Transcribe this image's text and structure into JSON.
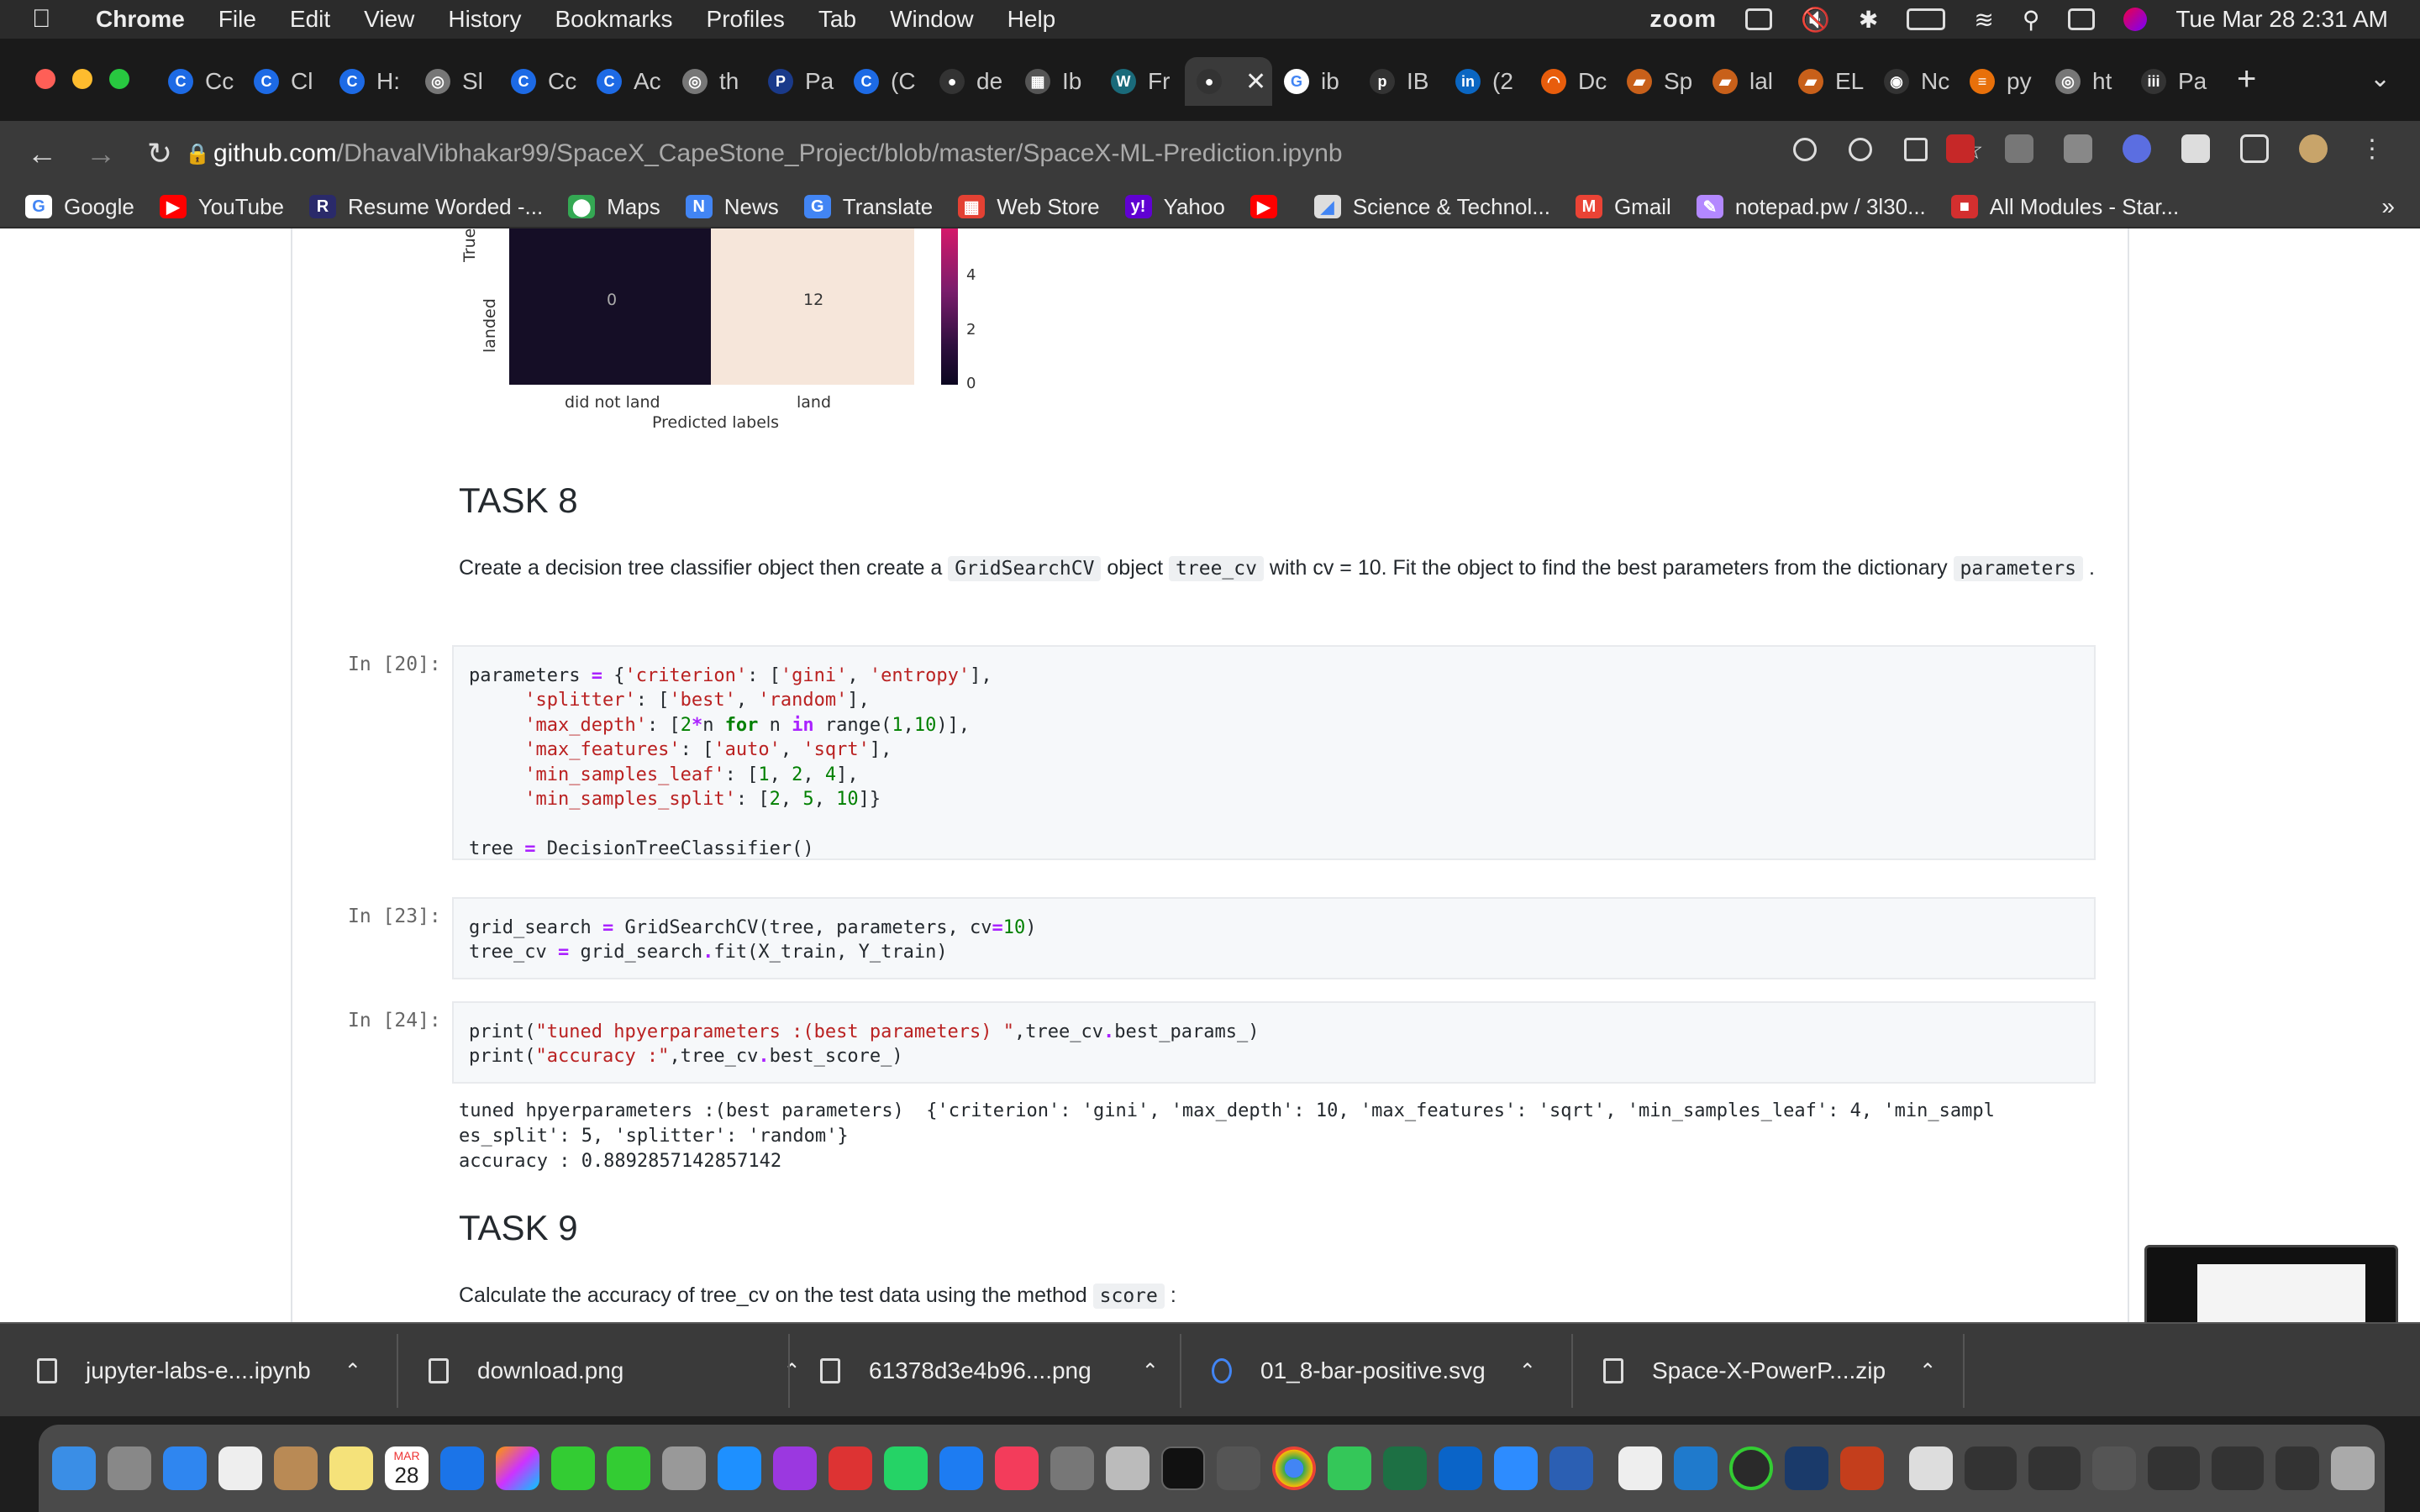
{
  "menubar": {
    "app": "Chrome",
    "items": [
      "File",
      "Edit",
      "View",
      "History",
      "Bookmarks",
      "Profiles",
      "Tab",
      "Window",
      "Help"
    ],
    "zoom_label": "zoom",
    "datetime": "Tue Mar 28  2:31 AM"
  },
  "tabs": [
    {
      "label": "Cc",
      "color": "#1d6ae5",
      "glyph": "C"
    },
    {
      "label": "Cl",
      "color": "#1d6ae5",
      "glyph": "C"
    },
    {
      "label": "H:",
      "color": "#1d6ae5",
      "glyph": "C"
    },
    {
      "label": "Sl",
      "color": "#777",
      "glyph": "◎"
    },
    {
      "label": "Cc",
      "color": "#1d6ae5",
      "glyph": "C"
    },
    {
      "label": "Ac",
      "color": "#1d6ae5",
      "glyph": "C"
    },
    {
      "label": "th",
      "color": "#777",
      "glyph": "◎"
    },
    {
      "label": "Pa",
      "color": "#1a3a8a",
      "glyph": "P"
    },
    {
      "label": "(C",
      "color": "#1d6ae5",
      "glyph": "C"
    },
    {
      "label": "de",
      "color": "#333",
      "glyph": "●"
    },
    {
      "label": "Ib",
      "color": "#555",
      "glyph": "▦"
    },
    {
      "label": "Fr",
      "color": "#1a6a7a",
      "glyph": "W"
    },
    {
      "label": "",
      "color": "#333",
      "glyph": "●",
      "active": true
    },
    {
      "label": "ib",
      "color": "#fff",
      "glyph": "G"
    },
    {
      "label": "IB",
      "color": "#333",
      "glyph": "p"
    },
    {
      "label": "(2",
      "color": "#0a66c2",
      "glyph": "in"
    },
    {
      "label": "Dc",
      "color": "#e85d0c",
      "glyph": "◠"
    },
    {
      "label": "Sp",
      "color": "#c8601a",
      "glyph": "▰"
    },
    {
      "label": "lal",
      "color": "#c8601a",
      "glyph": "▰"
    },
    {
      "label": "EL",
      "color": "#c8601a",
      "glyph": "▰"
    },
    {
      "label": "Nc",
      "color": "#333",
      "glyph": "◉"
    },
    {
      "label": "py",
      "color": "#e8700a",
      "glyph": "≡"
    },
    {
      "label": "ht",
      "color": "#777",
      "glyph": "◎"
    },
    {
      "label": "Pa",
      "color": "#333",
      "glyph": "iii"
    }
  ],
  "url": {
    "host": "github.com",
    "path": "/DhavalVibhakar99/SpaceX_CapeStone_Project/blob/master/SpaceX-ML-Prediction.ipynb"
  },
  "bookmarks": [
    {
      "label": "Google",
      "color": "#fff",
      "glyph": "G"
    },
    {
      "label": "YouTube",
      "color": "#ff0000",
      "glyph": "▶"
    },
    {
      "label": "Resume Worded -...",
      "color": "#2a2a6a",
      "glyph": "R"
    },
    {
      "label": "Maps",
      "color": "#34a853",
      "glyph": "⬤"
    },
    {
      "label": "News",
      "color": "#4285f4",
      "glyph": "N"
    },
    {
      "label": "Translate",
      "color": "#4285f4",
      "glyph": "G"
    },
    {
      "label": "Web Store",
      "color": "#e34133",
      "glyph": "▦"
    },
    {
      "label": "Yahoo",
      "color": "#6001d2",
      "glyph": "y!"
    },
    {
      "label": "",
      "color": "#ff0000",
      "glyph": "▶"
    },
    {
      "label": "Science & Technol...",
      "color": "#ddd",
      "glyph": "◢"
    },
    {
      "label": "Gmail",
      "color": "#ea4335",
      "glyph": "M"
    },
    {
      "label": "notepad.pw / 3l30...",
      "color": "#b388ff",
      "glyph": "✎"
    },
    {
      "label": "All Modules - Star...",
      "color": "#d32f2f",
      "glyph": "■"
    }
  ],
  "bookmarks_more": "»",
  "heatmap": {
    "row_label_true": "True",
    "row_label_landed": "landed",
    "cells": [
      "0",
      "12"
    ],
    "x_ticks": [
      "did not land",
      "land"
    ],
    "x_label": "Predicted labels",
    "colorbar_ticks": [
      "4",
      "2",
      "0"
    ]
  },
  "task8": {
    "title": "TASK 8",
    "text_before": "Create a decision tree classifier object then create a ",
    "code1": "GridSearchCV",
    "text_mid1": " object ",
    "code2": "tree_cv",
    "text_mid2": " with cv = 10. Fit the object to find the best parameters from the dictionary ",
    "code3": "parameters",
    "text_after": " ."
  },
  "cells": [
    {
      "prompt": "In [20]:"
    },
    {
      "prompt": "In [23]:"
    },
    {
      "prompt": "In [24]:"
    }
  ],
  "output24": {
    "line1": "tuned hpyerparameters :(best parameters)  {'criterion': 'gini', 'max_depth': 10, 'max_features': 'sqrt', 'min_samples_leaf': 4, 'min_sampl",
    "line2": "es_split': 5, 'splitter': 'random'}",
    "line3": "accuracy : 0.8892857142857142"
  },
  "task9": {
    "title": "TASK 9",
    "text": "Calculate the accuracy of tree_cv on the test data using the method ",
    "code": "score",
    "text_after": " :"
  },
  "downloads": [
    {
      "name": "jupyter-labs-e....ipynb"
    },
    {
      "name": "download.png"
    },
    {
      "name": "61378d3e4b96....png"
    },
    {
      "name": "01_8-bar-positive.svg"
    },
    {
      "name": "Space-X-PowerP....zip"
    }
  ],
  "dock": {
    "calendar_month": "MAR",
    "calendar_day": "28"
  }
}
